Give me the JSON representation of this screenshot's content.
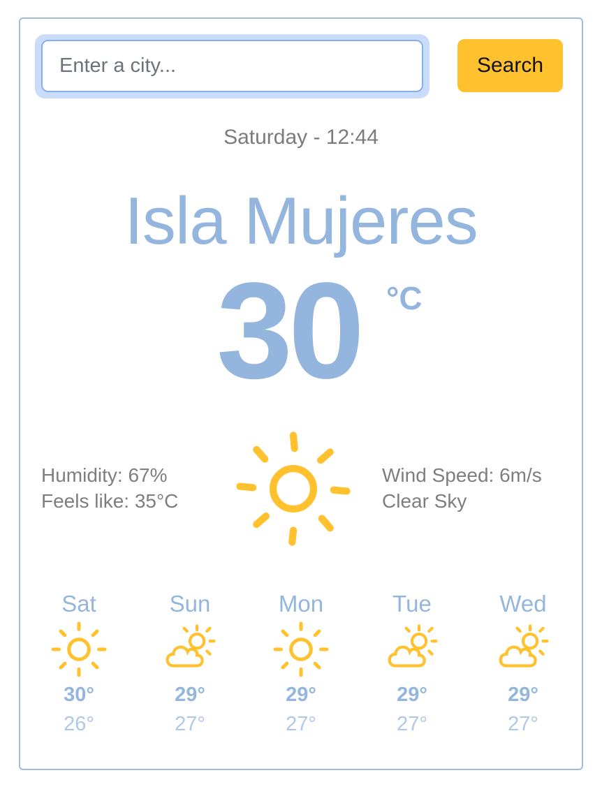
{
  "search": {
    "placeholder": "Enter a city...",
    "value": "",
    "button_label": "Search"
  },
  "current": {
    "datetime": "Saturday - 12:44",
    "city": "Isla Mujeres",
    "temperature": "30",
    "unit": "°C",
    "humidity": "Humidity: 67%",
    "feels_like": "Feels like: 35°C",
    "wind": "Wind Speed: 6m/s",
    "description": "Clear Sky",
    "icon": "sun-icon"
  },
  "forecast": [
    {
      "day": "Sat",
      "icon": "sun-icon",
      "high": "30°",
      "low": "26°"
    },
    {
      "day": "Sun",
      "icon": "cloud-sun-icon",
      "high": "29°",
      "low": "27°"
    },
    {
      "day": "Mon",
      "icon": "sun-icon",
      "high": "29°",
      "low": "27°"
    },
    {
      "day": "Tue",
      "icon": "cloud-sun-icon",
      "high": "29°",
      "low": "27°"
    },
    {
      "day": "Wed",
      "icon": "cloud-sun-icon",
      "high": "29°",
      "low": "27°"
    }
  ],
  "colors": {
    "accent": "#94b6de",
    "button": "#ffc12e",
    "icon": "#ffc12e",
    "text_muted": "#7e7e7e"
  }
}
